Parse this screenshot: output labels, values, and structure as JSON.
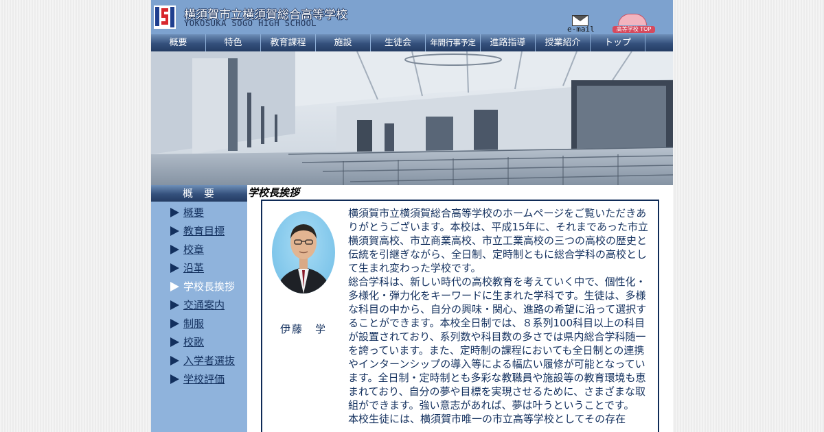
{
  "header": {
    "school_name_ja": "横須賀市立横須賀総合高等学校",
    "school_name_en": "YOKOSUKA SOGO HIGH SCHOOL",
    "email_label": "e-mail",
    "top_link_label": "高等学校 TOP",
    "logo_icon": "school-logo-icon"
  },
  "nav": {
    "items": [
      {
        "label": "概要"
      },
      {
        "label": "特色"
      },
      {
        "label": "教育課程"
      },
      {
        "label": "施設"
      },
      {
        "label": "生徒会"
      },
      {
        "label": "年間行事予定"
      },
      {
        "label": "進路指導"
      },
      {
        "label": "授業紹介"
      },
      {
        "label": "トップ"
      }
    ]
  },
  "sidebar": {
    "title": "概要",
    "items": [
      {
        "label": "概要",
        "current": false
      },
      {
        "label": "教育目標",
        "current": false
      },
      {
        "label": "校章",
        "current": false
      },
      {
        "label": "沿革",
        "current": false
      },
      {
        "label": "学校長挨拶",
        "current": true
      },
      {
        "label": "交通案内",
        "current": false
      },
      {
        "label": "制服",
        "current": false
      },
      {
        "label": "校歌",
        "current": false
      },
      {
        "label": "入学者選抜",
        "current": false
      },
      {
        "label": "学校評価",
        "current": false
      }
    ]
  },
  "main": {
    "heading": "学校長挨拶",
    "principal_name": "伊藤　学",
    "paragraphs": [
      "横須賀市立横須賀総合高等学校のホームページをご覧いただきありがとうございます。本校は、平成15年に、それまであった市立横須賀高校、市立商業高校、市立工業高校の三つの高校の歴史と伝統を引継ぎながら、全日制、定時制ともに総合学科の高校として生まれ変わった学校です。",
      "総合学科は、新しい時代の高校教育を考えていく中で、個性化・多様化・弾力化をキーワードに生まれた学科です。生徒は、多様な科目の中から、自分の興味・関心、進路の希望に沿って選択することができます。本校全日制では、８系列100科目以上の科目が設置されており、系列数や科目数の多さでは県内総合学科随一を誇っています。また、定時制の課程においても全日制との連携やインターンシップの導入等による幅広い履修が可能となっています。全日制・定時制とも多彩な教職員や施設等の教育環境も恵まれており、自分の夢や目標を実現させるために、さまざまな取組ができます。強い意志があれば、夢は叶うということです。",
      "本校生徒には、横須賀市唯一の市立高等学校としてその存在"
    ]
  },
  "colors": {
    "header_bg": "#7da2cf",
    "nav_dark": "#243c63",
    "sidebar_bg": "#8fb3dc",
    "text_navy": "#13305e"
  }
}
